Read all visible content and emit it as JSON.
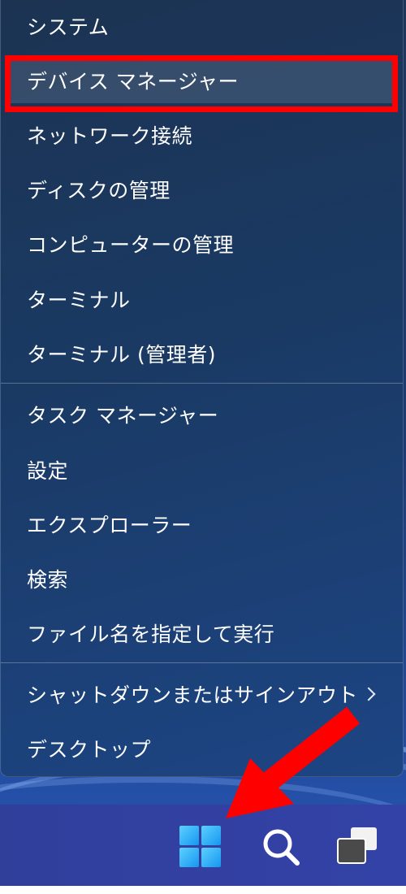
{
  "context_menu": {
    "items": [
      {
        "label": "システム"
      },
      {
        "label": "デバイス マネージャー"
      },
      {
        "label": "ネットワーク接続"
      },
      {
        "label": "ディスクの管理"
      },
      {
        "label": "コンピューターの管理"
      },
      {
        "label": "ターミナル"
      },
      {
        "label": "ターミナル (管理者)"
      },
      {
        "label": "タスク マネージャー"
      },
      {
        "label": "設定"
      },
      {
        "label": "エクスプローラー"
      },
      {
        "label": "検索"
      },
      {
        "label": "ファイル名を指定して実行"
      },
      {
        "label": "シャットダウンまたはサインアウト",
        "has_submenu": true
      },
      {
        "label": "デスクトップ"
      }
    ],
    "highlighted_item": "デバイス マネージャー"
  },
  "taskbar": {
    "buttons": [
      {
        "icon": "windows-start-icon"
      },
      {
        "icon": "search-icon"
      },
      {
        "icon": "task-view-icon"
      }
    ]
  },
  "annotations": {
    "highlight_box_color": "#ff0000",
    "arrow_color": "#ff0000",
    "arrow_target": "start-button"
  },
  "colors": {
    "menu_bg_top": "#1c3352",
    "menu_bg_bottom": "#1d4584",
    "taskbar_bg": "#3340a2",
    "start_icon": "#1597f0",
    "text": "#ffffff"
  }
}
